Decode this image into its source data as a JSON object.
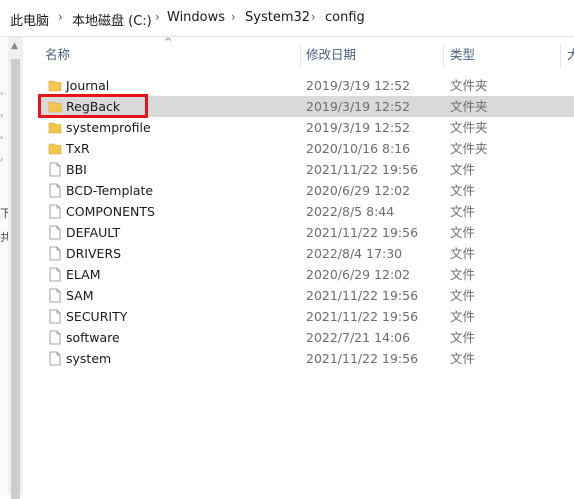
{
  "breadcrumb": [
    "此电脑",
    "本地磁盘 (C:)",
    "Windows",
    "System32",
    "config"
  ],
  "breadcrumb_sep": "›",
  "columns": {
    "name": "名称",
    "date": "修改日期",
    "type": "类型",
    "size": "大"
  },
  "left_fragments": [
    "下",
    "共"
  ],
  "files": [
    {
      "name": "Journal",
      "date": "2019/3/19 12:52",
      "type": "文件夹",
      "icon": "folder-icon"
    },
    {
      "name": "RegBack",
      "date": "2019/3/19 12:52",
      "type": "文件夹",
      "icon": "folder-icon",
      "selected": true
    },
    {
      "name": "systemprofile",
      "date": "2019/3/19 12:52",
      "type": "文件夹",
      "icon": "folder-icon"
    },
    {
      "name": "TxR",
      "date": "2020/10/16 8:16",
      "type": "文件夹",
      "icon": "folder-icon"
    },
    {
      "name": "BBI",
      "date": "2021/11/22 19:56",
      "type": "文件",
      "icon": "file-icon"
    },
    {
      "name": "BCD-Template",
      "date": "2020/6/29 12:02",
      "type": "文件",
      "icon": "file-icon"
    },
    {
      "name": "COMPONENTS",
      "date": "2022/8/5 8:44",
      "type": "文件",
      "icon": "file-icon"
    },
    {
      "name": "DEFAULT",
      "date": "2021/11/22 19:56",
      "type": "文件",
      "icon": "file-icon"
    },
    {
      "name": "DRIVERS",
      "date": "2022/8/4 17:30",
      "type": "文件",
      "icon": "file-icon"
    },
    {
      "name": "ELAM",
      "date": "2020/6/29 12:02",
      "type": "文件",
      "icon": "file-icon"
    },
    {
      "name": "SAM",
      "date": "2021/11/22 19:56",
      "type": "文件",
      "icon": "file-icon"
    },
    {
      "name": "SECURITY",
      "date": "2021/11/22 19:56",
      "type": "文件",
      "icon": "file-icon"
    },
    {
      "name": "software",
      "date": "2022/7/21 14:06",
      "type": "文件",
      "icon": "file-icon"
    },
    {
      "name": "system",
      "date": "2021/11/22 19:56",
      "type": "文件",
      "icon": "file-icon"
    }
  ],
  "colors": {
    "selection": "#d9d9d9",
    "highlight_box": "#e8141b",
    "folder": "#f3c74d"
  }
}
